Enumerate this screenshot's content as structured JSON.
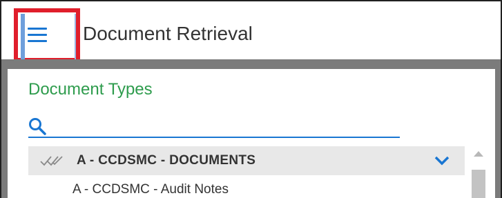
{
  "header": {
    "menu_icon": "hamburger-menu-icon",
    "title": "Document Retrieval",
    "highlight_color": "#e01e2b"
  },
  "panel": {
    "title": "Document Types",
    "title_color": "#2e9c4d",
    "search": {
      "icon": "search-icon",
      "value": "",
      "placeholder": ""
    }
  },
  "list": {
    "group": {
      "icon": "double-check-icon",
      "label": "A - CCDSMC - DOCUMENTS",
      "expand_icon": "chevron-down-icon",
      "expanded": true
    },
    "items": [
      {
        "label": "A - CCDSMC - Audit Notes"
      }
    ]
  },
  "colors": {
    "accent": "#1976d2",
    "band": "#7b7b7b"
  }
}
